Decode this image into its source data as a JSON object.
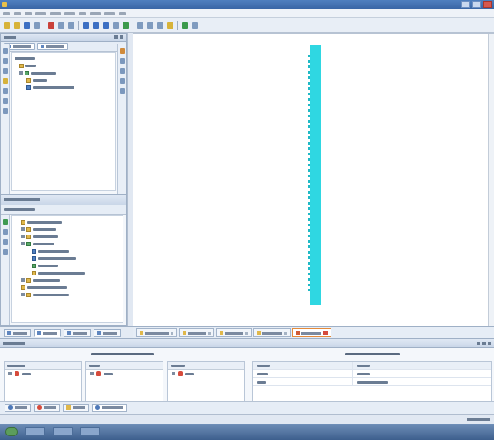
{
  "window": {
    "title": ""
  },
  "menu": {
    "items": [
      "",
      "",
      "",
      "",
      "",
      "",
      "",
      "",
      "",
      ""
    ]
  },
  "design_panel": {
    "title": "",
    "view_tabs": [
      "",
      ""
    ],
    "hierarchy_label": ""
  },
  "processes_panel": {
    "title": "",
    "running_label": ""
  },
  "left_tabs": [
    "",
    "",
    "",
    ""
  ],
  "doc_tabs": [
    "",
    "",
    "",
    "",
    ""
  ],
  "bottom_panel": {
    "title": "",
    "left_header": "",
    "right_header": "",
    "columns": [
      "",
      "",
      ""
    ],
    "props_header": [
      "",
      ""
    ],
    "props_rows": [
      [
        "",
        ""
      ],
      [
        "",
        ""
      ]
    ]
  },
  "console_tabs": [
    "",
    "",
    "",
    ""
  ],
  "status": {
    "text": ""
  },
  "colors": {
    "cyan_strip": "#2fd7e2",
    "titlebar": "#3a66a6",
    "error_red": "#d64b3c"
  }
}
